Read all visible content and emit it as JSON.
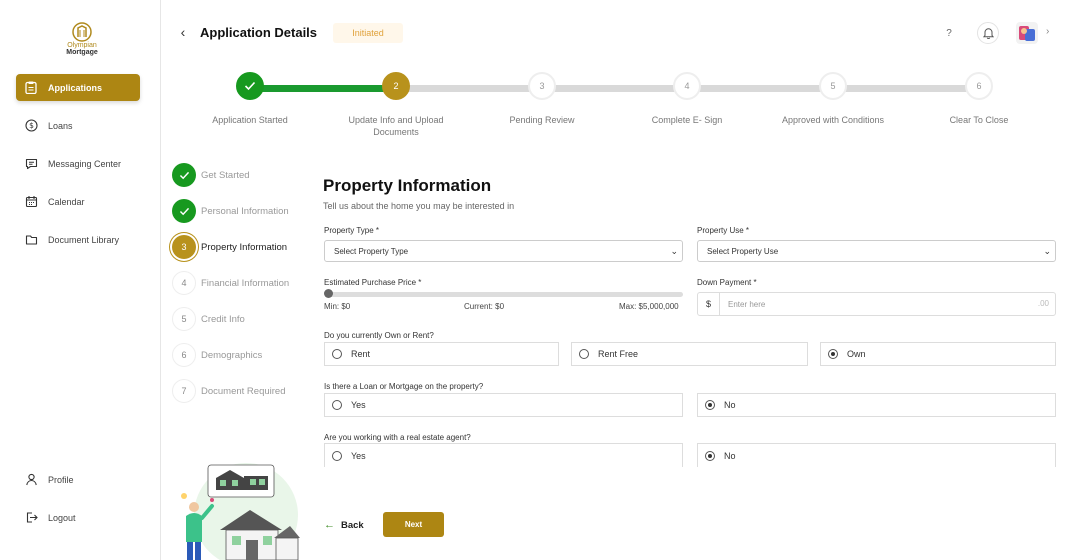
{
  "brand": {
    "line1": "Olympian",
    "line2": "Mortgage"
  },
  "sidebar": {
    "items": [
      {
        "label": "Applications",
        "icon": "applications-icon",
        "active": true
      },
      {
        "label": "Loans",
        "icon": "loans-icon"
      },
      {
        "label": "Messaging Center",
        "icon": "message-icon"
      },
      {
        "label": "Calendar",
        "icon": "calendar-icon"
      },
      {
        "label": "Document Library",
        "icon": "folder-icon"
      }
    ],
    "bottom": [
      {
        "label": "Profile",
        "icon": "profile-icon"
      },
      {
        "label": "Logout",
        "icon": "logout-icon"
      }
    ]
  },
  "header": {
    "title": "Application Details",
    "status": "Initiated",
    "help": "?"
  },
  "progress": {
    "steps": [
      {
        "num": "1",
        "label": "Application Started"
      },
      {
        "num": "2",
        "label": "Update Info and Upload Documents"
      },
      {
        "num": "3",
        "label": "Pending Review"
      },
      {
        "num": "4",
        "label": "Complete E- Sign"
      },
      {
        "num": "5",
        "label": "Approved with Conditions"
      },
      {
        "num": "6",
        "label": "Clear To Close"
      }
    ]
  },
  "substeps": [
    {
      "num": "1",
      "label": "Get Started"
    },
    {
      "num": "2",
      "label": "Personal Information"
    },
    {
      "num": "3",
      "label": "Property Information"
    },
    {
      "num": "4",
      "label": "Financial Information"
    },
    {
      "num": "5",
      "label": "Credit Info"
    },
    {
      "num": "6",
      "label": "Demographics"
    },
    {
      "num": "7",
      "label": "Document Required"
    }
  ],
  "form": {
    "title": "Property Information",
    "subtitle": "Tell us about the home you may be interested in",
    "property_type": {
      "label": "Property Type *",
      "value": "Select Property Type"
    },
    "property_use": {
      "label": "Property Use *",
      "value": "Select Property Use"
    },
    "price": {
      "label": "Estimated Purchase Price *",
      "min": "Min: $0",
      "current": "Current: $0",
      "max": "Max: $5,000,000",
      "level": 0
    },
    "down_payment": {
      "label": "Down Payment  *",
      "currency": "$",
      "placeholder": "Enter here",
      "decimal": ".00"
    },
    "own_rent": {
      "label": "Do you currently Own or Rent?",
      "options": [
        "Rent",
        "Rent Free",
        "Own"
      ],
      "selected": "Own"
    },
    "loan": {
      "label": "Is there a Loan or Mortgage on the property?",
      "options": [
        "Yes",
        "No"
      ],
      "selected": "No"
    },
    "agent": {
      "label": "Are you working with a real estate agent?",
      "options": [
        "Yes",
        "No"
      ],
      "selected": "No"
    }
  },
  "actions": {
    "back": "Back",
    "next": "Next"
  },
  "colors": {
    "accent": "#ad8613",
    "success": "#17991f",
    "badge": "#e0a23c"
  }
}
